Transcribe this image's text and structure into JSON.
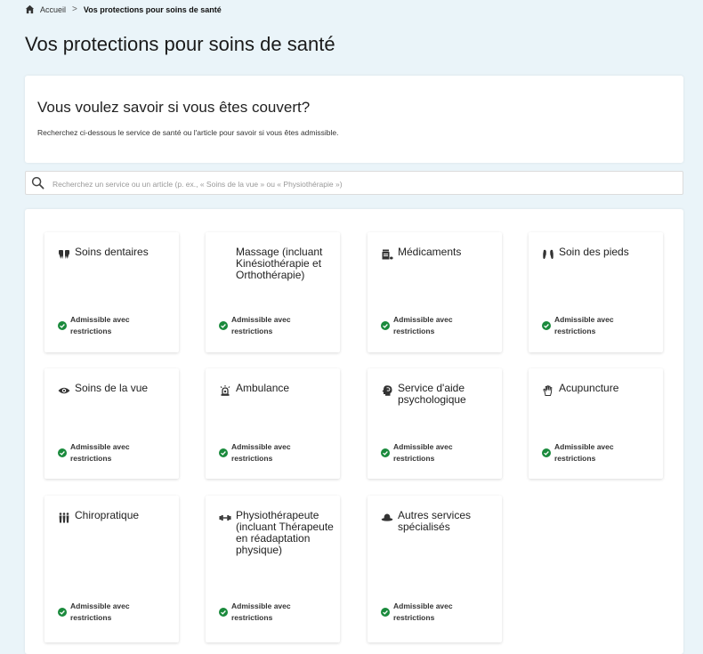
{
  "breadcrumb": {
    "home": "Accueil",
    "separator": ">",
    "current": "Vos protections pour soins de santé"
  },
  "page_title": "Vos protections pour soins de santé",
  "intro": {
    "heading": "Vous voulez savoir si vous êtes couvert?",
    "text": "Recherchez ci-dessous le service de santé ou l'article pour savoir si vous êtes admissible."
  },
  "search": {
    "placeholder": "Recherchez un service ou un article (p. ex., « Soins de la vue » ou « Physiothérapie »)"
  },
  "colors": {
    "check": "#1a8a3c",
    "background": "#eaf4f9"
  },
  "tiles": [
    {
      "title": "Soins dentaires",
      "icon": "teeth-icon",
      "status": "Admissible avec restrictions"
    },
    {
      "title": "Massage (incluant Kinésiothérapie et Orthothérapie)",
      "icon": "",
      "status": "Admissible avec restrictions"
    },
    {
      "title": "Médicaments",
      "icon": "pill-bottle-icon",
      "status": "Admissible avec restrictions"
    },
    {
      "title": "Soin des pieds",
      "icon": "feet-icon",
      "status": "Admissible avec restrictions"
    },
    {
      "title": "Soins de la vue",
      "icon": "eye-icon",
      "status": "Admissible avec restrictions"
    },
    {
      "title": "Ambulance",
      "icon": "siren-icon",
      "status": "Admissible avec restrictions"
    },
    {
      "title": "Service d'aide psychologique",
      "icon": "head-brain-icon",
      "status": "Admissible avec restrictions"
    },
    {
      "title": "Acupuncture",
      "icon": "hand-icon",
      "status": "Admissible avec restrictions"
    },
    {
      "title": "Chiropratique",
      "icon": "spine-icon",
      "status": "Admissible avec restrictions"
    },
    {
      "title": "Physiothérapeute (incluant Thérapeute en réadaptation physique)",
      "icon": "dumbbell-icon",
      "status": "Admissible avec restrictions"
    },
    {
      "title": "Autres services spécialisés",
      "icon": "hat-icon",
      "status": "Admissible avec restrictions"
    }
  ]
}
